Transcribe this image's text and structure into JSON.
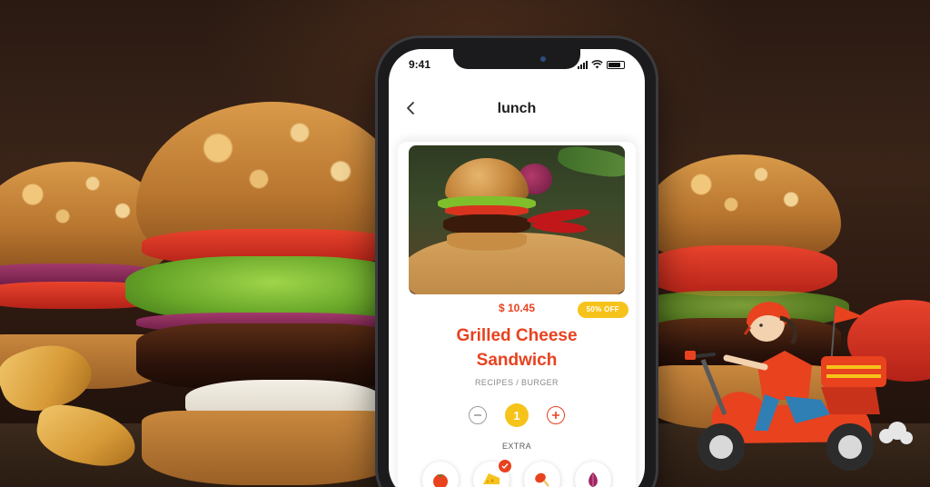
{
  "status_bar": {
    "time": "9:41"
  },
  "nav": {
    "title": "lunch"
  },
  "product": {
    "price": "$ 10.45",
    "discount": "50% OFF",
    "name_line1": "Grilled Cheese",
    "name_line2": "Sandwich",
    "category": "RECIPES / BURGER",
    "quantity": "1"
  },
  "extras": {
    "label": "EXTRA",
    "items": [
      {
        "icon": "tomato-icon",
        "selected": false
      },
      {
        "icon": "cheese-icon",
        "selected": true
      },
      {
        "icon": "chicken-leg-icon",
        "selected": false
      },
      {
        "icon": "onion-icon",
        "selected": false
      }
    ]
  },
  "colors": {
    "accent": "#e8421f",
    "badge": "#f6c31a"
  }
}
